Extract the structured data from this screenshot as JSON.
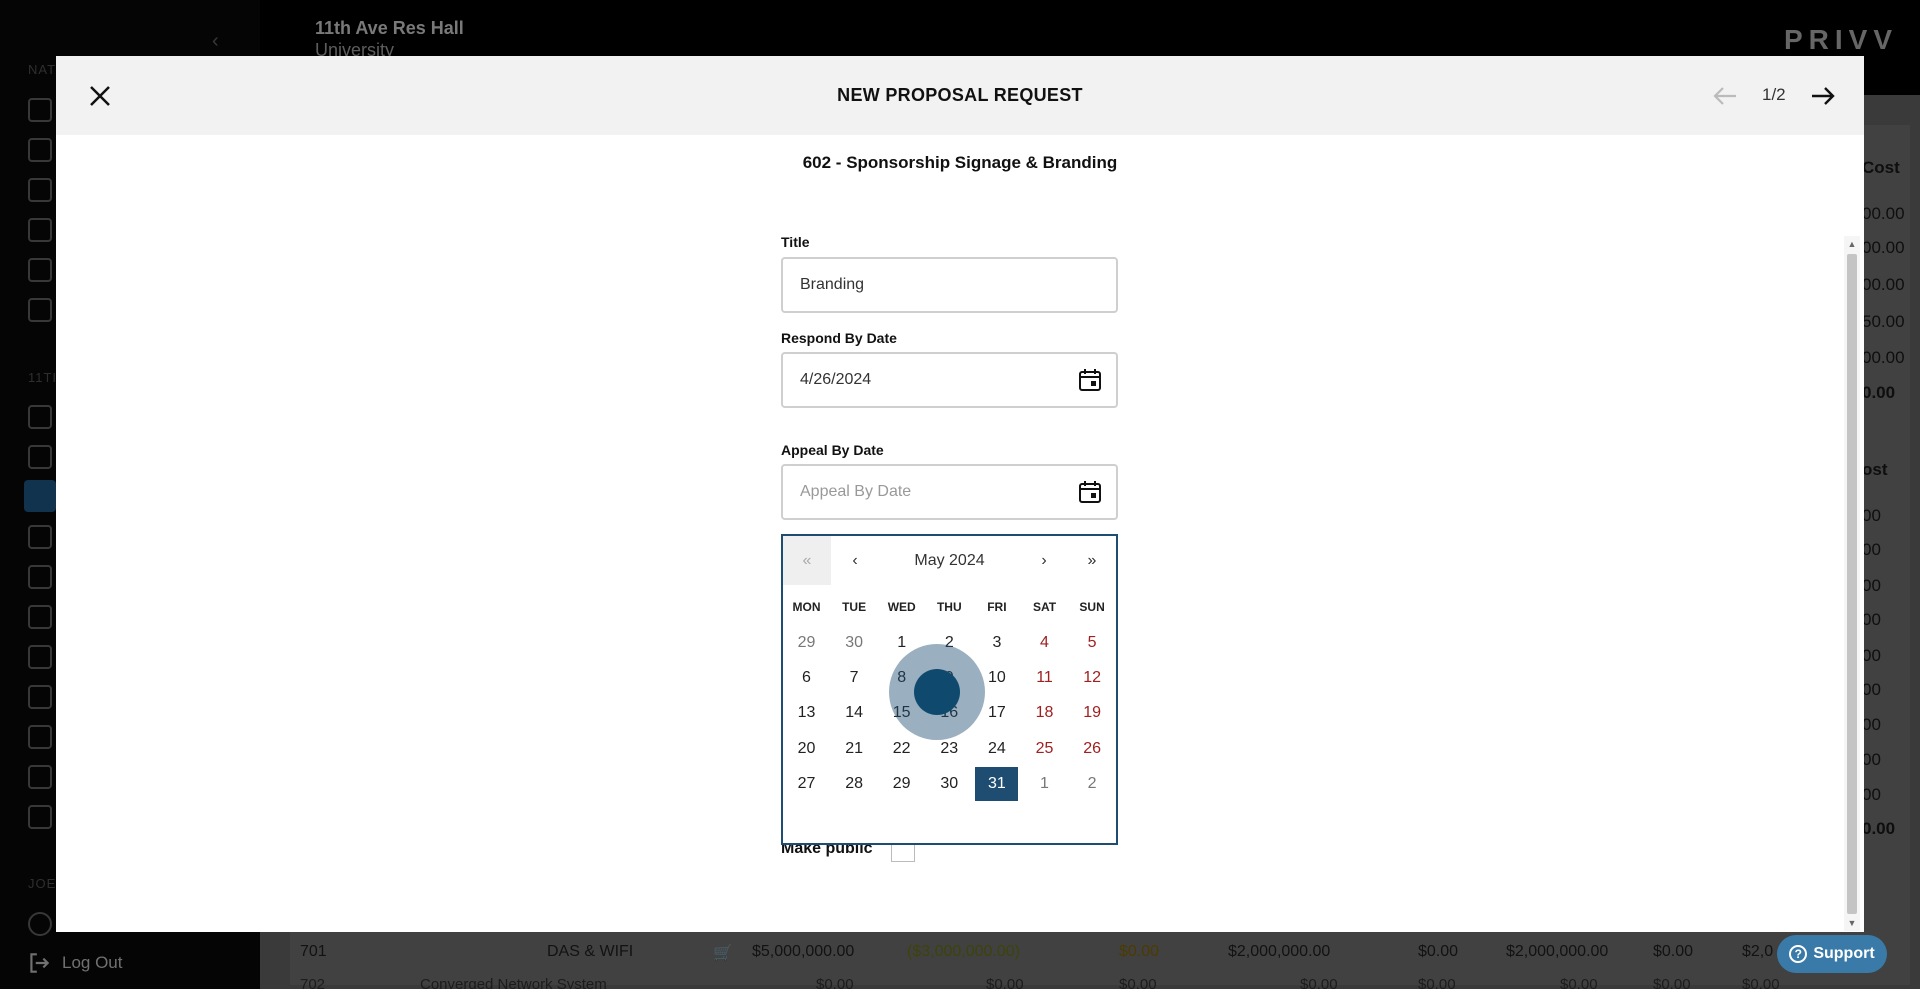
{
  "background": {
    "org_name": "11th Ave Res Hall",
    "org_sub": "University",
    "logo": "PRIVV",
    "sidebar_sections": [
      "NAT",
      "11TI",
      "JOE"
    ],
    "logout_label": "Log Out",
    "right_values": [
      "Cost",
      "00.00",
      "00.00",
      "00.00",
      "50.00",
      "00.00",
      "0.00",
      "ost",
      "00",
      "00",
      "00",
      "00",
      "00",
      "00",
      "00",
      "00",
      "00",
      "0.00"
    ],
    "bottom_row": {
      "code": "701",
      "name": "DAS & WIFI",
      "budget": "$5,000,000.00",
      "delta": "($3,000,000.00)",
      "zero1": "$0.00",
      "total": "$2,000,000.00",
      "zero2": "$0.00",
      "total2": "$2,000,000.00",
      "zero3": "$0.00",
      "tail": "$2,0"
    },
    "bottom_row2": {
      "code": "702",
      "name": "Converged Network System",
      "v1": "$0.00",
      "v2": "$0.00",
      "v3": "$0.00",
      "v4": "$0.00",
      "v5": "$0.00",
      "v6": "$0.00",
      "v7": "$0.00",
      "v8": "$0.00"
    }
  },
  "modal": {
    "title": "NEW PROPOSAL REQUEST",
    "page_count": "1/2",
    "section_title": "602 - Sponsorship Signage & Branding",
    "title_label": "Title",
    "title_value": "Branding",
    "respond_label": "Respond By Date",
    "respond_value": "4/26/2024",
    "appeal_label": "Appeal By Date",
    "appeal_placeholder": "Appeal By Date",
    "make_public_label": "Make public"
  },
  "datepicker": {
    "month_label": "May 2024",
    "nav": {
      "prev_year": "«",
      "prev_month": "‹",
      "next_month": "›",
      "next_year": "»"
    },
    "weekdays": [
      "MON",
      "TUE",
      "WED",
      "THU",
      "FRI",
      "SAT",
      "SUN"
    ],
    "weeks": [
      [
        "29",
        "30",
        "1",
        "2",
        "3",
        "4",
        "5"
      ],
      [
        "6",
        "7",
        "8",
        "9",
        "10",
        "11",
        "12"
      ],
      [
        "13",
        "14",
        "15",
        "16",
        "17",
        "18",
        "19"
      ],
      [
        "20",
        "21",
        "22",
        "23",
        "24",
        "25",
        "26"
      ],
      [
        "27",
        "28",
        "29",
        "30",
        "31",
        "1",
        "2"
      ]
    ]
  },
  "support_label": "Support",
  "colors": {
    "accent": "#1f4d72",
    "weekend": "#a02020",
    "support": "#3a7aa8"
  }
}
